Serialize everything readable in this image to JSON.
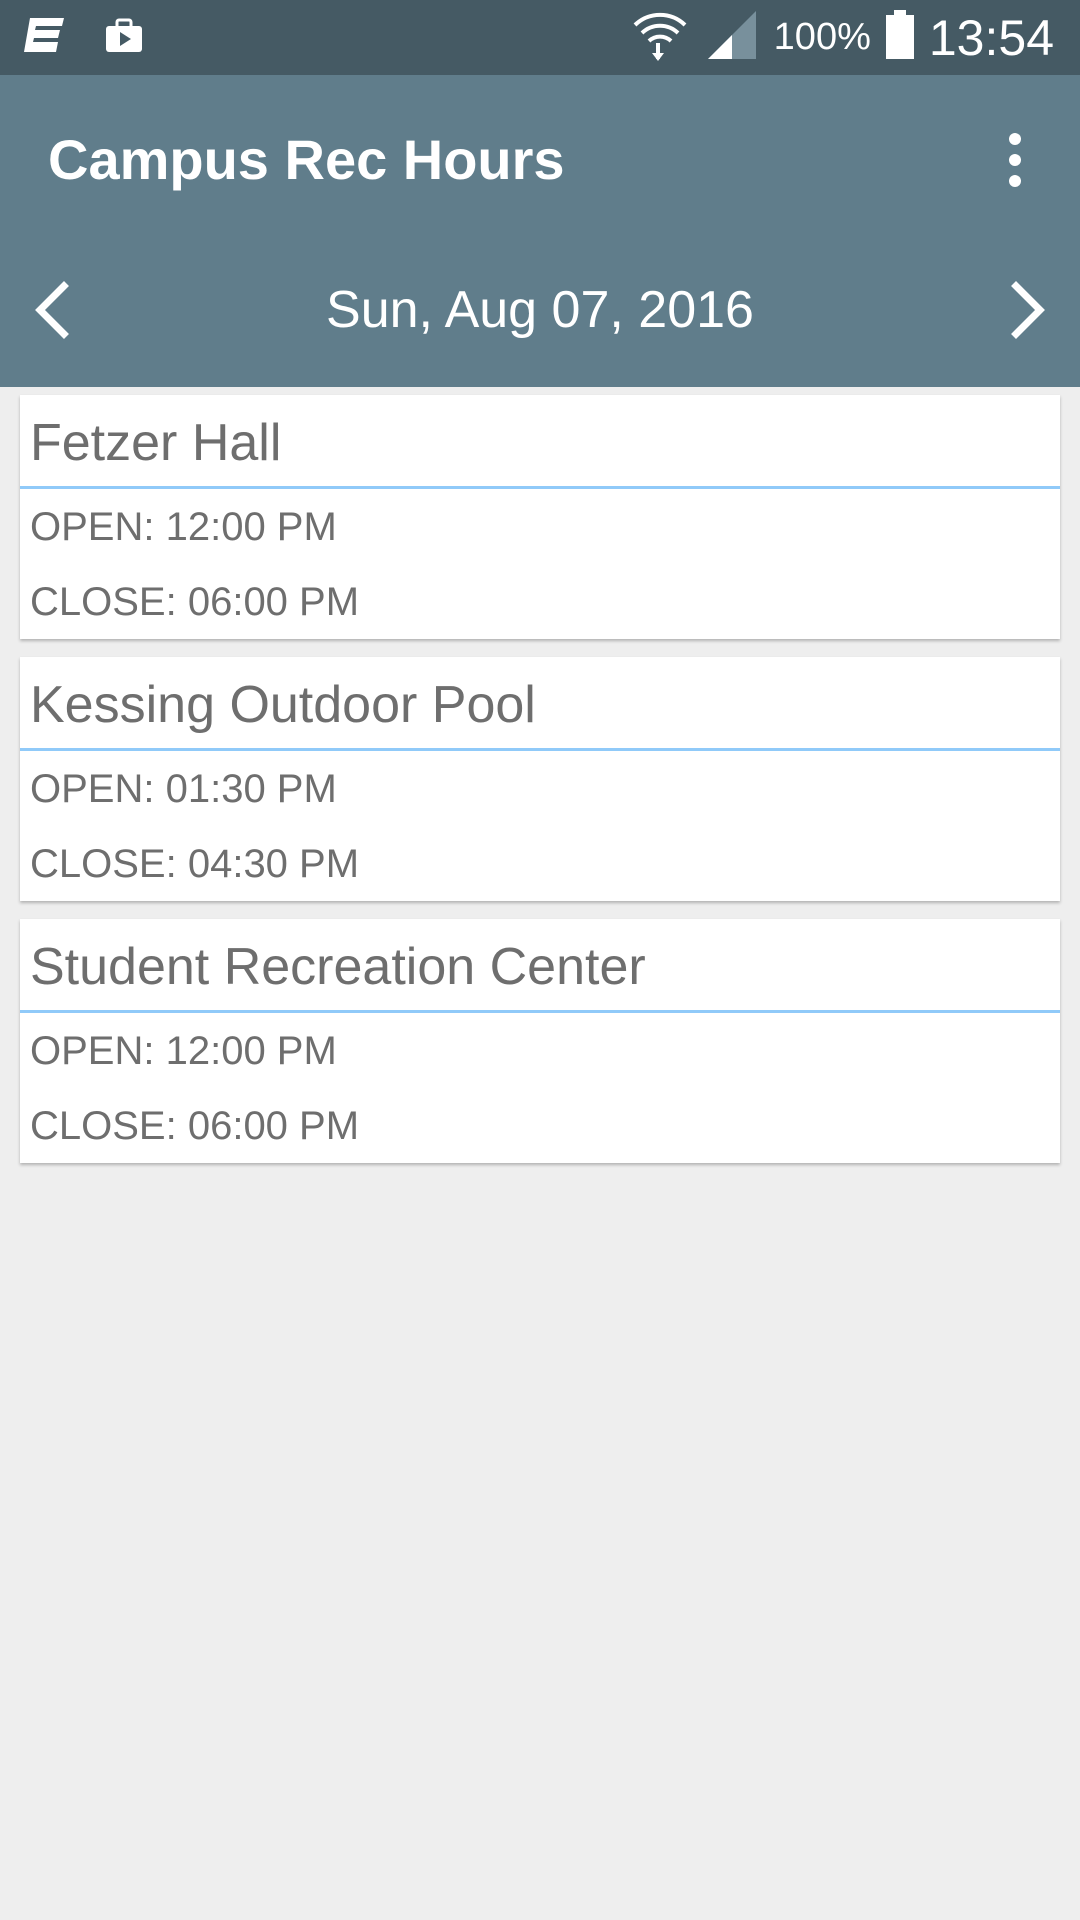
{
  "status_bar": {
    "icons_left": [
      "messaging-icon",
      "briefcase-icon"
    ],
    "icons_right": [
      "wifi-icon",
      "signal-icon",
      "battery-icon"
    ],
    "battery": "100%",
    "time": "13:54"
  },
  "app_bar": {
    "title": "Campus Rec Hours",
    "overflow_icon": "more-vert-icon",
    "date": "Sun, Aug 07, 2016",
    "prev_icon": "chevron-left-icon",
    "next_icon": "chevron-right-icon"
  },
  "facilities": [
    {
      "name": "Fetzer Hall",
      "open": "OPEN: 12:00 PM",
      "close": "CLOSE: 06:00 PM"
    },
    {
      "name": "Kessing Outdoor Pool",
      "open": "OPEN: 01:30 PM",
      "close": "CLOSE: 04:30 PM"
    },
    {
      "name": "Student Recreation Center",
      "open": "OPEN: 12:00 PM",
      "close": "CLOSE: 06:00 PM"
    }
  ],
  "colors": {
    "status_bar": "#455a64",
    "app_bar": "#607d8b",
    "background": "#eeeeee",
    "divider": "#90caf9",
    "text": "#6e6e6e"
  }
}
